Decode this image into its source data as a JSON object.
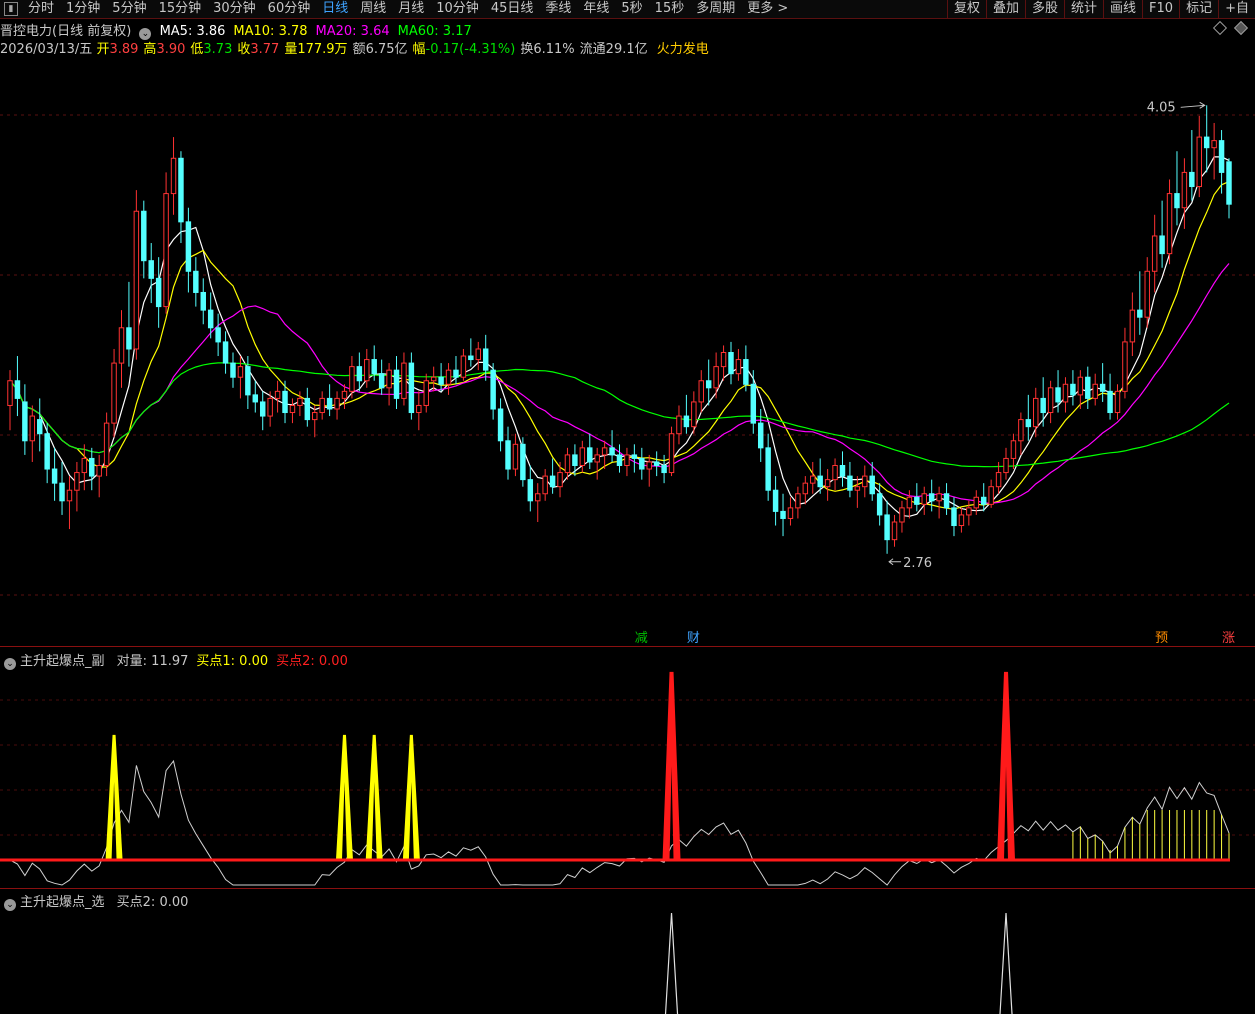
{
  "toolbar": {
    "periods": [
      "分时",
      "1分钟",
      "5分钟",
      "15分钟",
      "30分钟",
      "60分钟",
      "日线",
      "周线",
      "月线",
      "10分钟",
      "45日线",
      "季线",
      "年线",
      "5秒",
      "15秒",
      "多周期",
      "更多 >"
    ],
    "active_period": "日线",
    "right_buttons": [
      "复权",
      "叠加",
      "多股",
      "统计",
      "画线",
      "F10",
      "标记",
      "+自"
    ]
  },
  "header": {
    "stock": "晋控电力(日线 前复权)",
    "ma": [
      {
        "label": "MA5: 3.86",
        "color": "#ffffff"
      },
      {
        "label": "MA10: 3.78",
        "color": "#ffff00"
      },
      {
        "label": "MA20: 3.64",
        "color": "#ff00ff"
      },
      {
        "label": "MA60: 3.17",
        "color": "#00ff00"
      }
    ],
    "date": "2026/03/13/五",
    "quote": [
      {
        "k": "开",
        "v": "3.89",
        "color": "#ff4040"
      },
      {
        "k": "高",
        "v": "3.90",
        "color": "#ff4040"
      },
      {
        "k": "低",
        "v": "3.73",
        "color": "#00e000"
      },
      {
        "k": "收",
        "v": "3.77",
        "color": "#ff4040"
      },
      {
        "k": "量",
        "v": "177.9万",
        "color": "#ffff00"
      },
      {
        "k": "额",
        "v": "6.75亿",
        "color": "#c8c8c8"
      },
      {
        "k": "幅",
        "v": "-0.17(-4.31%)",
        "color": "#00e000"
      },
      {
        "k": "换",
        "v": "6.11%",
        "color": "#c8c8c8"
      },
      {
        "k": "流通",
        "v": "29.1亿",
        "color": "#c8c8c8"
      }
    ],
    "sector": "火力发电"
  },
  "panel1": {
    "title": "主升起爆点_副",
    "fields": [
      {
        "label": "对量: 11.97",
        "color": "#c8c8c8"
      },
      {
        "label": "买点1: 0.00",
        "color": "#ffff00"
      },
      {
        "label": "买点2: 0.00",
        "color": "#ff2020"
      }
    ]
  },
  "panel2": {
    "title": "主升起爆点_选",
    "fields": [
      {
        "label": "买点2: 0.00",
        "color": "#c8c8c8"
      }
    ]
  },
  "chart_data": {
    "type": "candlestick",
    "ylim": [
      2.55,
      4.15
    ],
    "high_label": "4.05",
    "low_label": "2.76",
    "markers": [
      {
        "text": "减",
        "index": 85,
        "color": "#00c000"
      },
      {
        "text": "财",
        "index": 92,
        "color": "#3fa3ff"
      },
      {
        "text": "预",
        "index": 155,
        "color": "#ff8c00"
      },
      {
        "text": "涨",
        "index": 164,
        "color": "#ff4040"
      }
    ],
    "candles": [
      [
        3.2,
        3.3,
        3.13,
        3.27
      ],
      [
        3.27,
        3.34,
        3.17,
        3.22
      ],
      [
        3.21,
        3.26,
        3.06,
        3.1
      ],
      [
        3.1,
        3.2,
        3.04,
        3.17
      ],
      [
        3.16,
        3.22,
        3.07,
        3.12
      ],
      [
        3.12,
        3.15,
        2.98,
        3.02
      ],
      [
        3.02,
        3.08,
        2.93,
        2.98
      ],
      [
        2.98,
        3.04,
        2.89,
        2.93
      ],
      [
        2.93,
        3.0,
        2.85,
        2.96
      ],
      [
        2.96,
        3.04,
        2.9,
        3.01
      ],
      [
        3.01,
        3.09,
        2.96,
        3.05
      ],
      [
        3.05,
        3.08,
        2.96,
        3.0
      ],
      [
        3.0,
        3.06,
        2.94,
        3.03
      ],
      [
        3.03,
        3.18,
        3.0,
        3.15
      ],
      [
        3.15,
        3.36,
        3.11,
        3.32
      ],
      [
        3.32,
        3.47,
        3.25,
        3.42
      ],
      [
        3.42,
        3.55,
        3.31,
        3.36
      ],
      [
        3.36,
        3.81,
        3.33,
        3.75
      ],
      [
        3.75,
        3.78,
        3.56,
        3.61
      ],
      [
        3.61,
        3.66,
        3.49,
        3.56
      ],
      [
        3.56,
        3.62,
        3.42,
        3.48
      ],
      [
        3.48,
        3.86,
        3.46,
        3.8
      ],
      [
        3.8,
        3.96,
        3.74,
        3.9
      ],
      [
        3.9,
        3.92,
        3.66,
        3.72
      ],
      [
        3.72,
        3.76,
        3.52,
        3.58
      ],
      [
        3.58,
        3.62,
        3.48,
        3.52
      ],
      [
        3.52,
        3.56,
        3.43,
        3.47
      ],
      [
        3.47,
        3.52,
        3.39,
        3.42
      ],
      [
        3.42,
        3.46,
        3.34,
        3.38
      ],
      [
        3.38,
        3.41,
        3.29,
        3.32
      ],
      [
        3.32,
        3.35,
        3.25,
        3.28
      ],
      [
        3.28,
        3.34,
        3.22,
        3.31
      ],
      [
        3.31,
        3.34,
        3.19,
        3.23
      ],
      [
        3.23,
        3.27,
        3.18,
        3.21
      ],
      [
        3.21,
        3.24,
        3.13,
        3.17
      ],
      [
        3.17,
        3.24,
        3.14,
        3.22
      ],
      [
        3.22,
        3.27,
        3.18,
        3.24
      ],
      [
        3.24,
        3.27,
        3.15,
        3.18
      ],
      [
        3.18,
        3.22,
        3.15,
        3.2
      ],
      [
        3.2,
        3.24,
        3.17,
        3.22
      ],
      [
        3.22,
        3.25,
        3.14,
        3.16
      ],
      [
        3.16,
        3.2,
        3.11,
        3.18
      ],
      [
        3.18,
        3.24,
        3.16,
        3.22
      ],
      [
        3.22,
        3.26,
        3.17,
        3.19
      ],
      [
        3.19,
        3.24,
        3.16,
        3.22
      ],
      [
        3.22,
        3.26,
        3.19,
        3.24
      ],
      [
        3.24,
        3.34,
        3.22,
        3.31
      ],
      [
        3.31,
        3.35,
        3.24,
        3.27
      ],
      [
        3.27,
        3.36,
        3.25,
        3.33
      ],
      [
        3.33,
        3.37,
        3.27,
        3.29
      ],
      [
        3.29,
        3.33,
        3.23,
        3.25
      ],
      [
        3.25,
        3.32,
        3.2,
        3.3
      ],
      [
        3.3,
        3.34,
        3.19,
        3.22
      ],
      [
        3.22,
        3.35,
        3.2,
        3.32
      ],
      [
        3.32,
        3.35,
        3.16,
        3.18
      ],
      [
        3.18,
        3.24,
        3.13,
        3.2
      ],
      [
        3.2,
        3.29,
        3.18,
        3.27
      ],
      [
        3.27,
        3.31,
        3.24,
        3.28
      ],
      [
        3.28,
        3.32,
        3.24,
        3.26
      ],
      [
        3.26,
        3.32,
        3.23,
        3.3
      ],
      [
        3.3,
        3.34,
        3.26,
        3.28
      ],
      [
        3.28,
        3.36,
        3.27,
        3.34
      ],
      [
        3.34,
        3.39,
        3.31,
        3.33
      ],
      [
        3.33,
        3.38,
        3.3,
        3.36
      ],
      [
        3.36,
        3.4,
        3.27,
        3.3
      ],
      [
        3.3,
        3.32,
        3.16,
        3.19
      ],
      [
        3.19,
        3.22,
        3.07,
        3.1
      ],
      [
        3.1,
        3.14,
        2.99,
        3.02
      ],
      [
        3.02,
        3.12,
        3.0,
        3.09
      ],
      [
        3.09,
        3.11,
        2.97,
        2.99
      ],
      [
        2.99,
        3.03,
        2.9,
        2.93
      ],
      [
        2.93,
        2.98,
        2.87,
        2.95
      ],
      [
        2.95,
        3.02,
        2.93,
        3.0
      ],
      [
        3.0,
        3.05,
        2.95,
        2.97
      ],
      [
        2.97,
        3.04,
        2.94,
        3.01
      ],
      [
        3.01,
        3.08,
        2.99,
        3.06
      ],
      [
        3.06,
        3.09,
        3.0,
        3.03
      ],
      [
        3.03,
        3.1,
        3.01,
        3.08
      ],
      [
        3.08,
        3.12,
        3.02,
        3.04
      ],
      [
        3.04,
        3.08,
        2.99,
        3.06
      ],
      [
        3.06,
        3.1,
        3.02,
        3.08
      ],
      [
        3.08,
        3.13,
        3.04,
        3.06
      ],
      [
        3.06,
        3.09,
        3.01,
        3.03
      ],
      [
        3.03,
        3.08,
        3.0,
        3.06
      ],
      [
        3.06,
        3.09,
        3.01,
        3.05
      ],
      [
        3.05,
        3.08,
        2.99,
        3.02
      ],
      [
        3.02,
        3.06,
        2.97,
        3.04
      ],
      [
        3.04,
        3.07,
        3.0,
        3.03
      ],
      [
        3.03,
        3.06,
        2.98,
        3.01
      ],
      [
        3.01,
        3.14,
        3.0,
        3.12
      ],
      [
        3.12,
        3.2,
        3.09,
        3.17
      ],
      [
        3.17,
        3.23,
        3.12,
        3.14
      ],
      [
        3.14,
        3.24,
        3.12,
        3.21
      ],
      [
        3.21,
        3.3,
        3.18,
        3.27
      ],
      [
        3.27,
        3.33,
        3.2,
        3.25
      ],
      [
        3.25,
        3.35,
        3.22,
        3.31
      ],
      [
        3.31,
        3.37,
        3.27,
        3.35
      ],
      [
        3.35,
        3.38,
        3.26,
        3.29
      ],
      [
        3.29,
        3.36,
        3.27,
        3.33
      ],
      [
        3.33,
        3.37,
        3.24,
        3.26
      ],
      [
        3.26,
        3.3,
        3.12,
        3.15
      ],
      [
        3.15,
        3.19,
        3.04,
        3.08
      ],
      [
        3.08,
        3.12,
        2.93,
        2.96
      ],
      [
        2.96,
        3.0,
        2.86,
        2.9
      ],
      [
        2.9,
        2.95,
        2.83,
        2.88
      ],
      [
        2.88,
        2.94,
        2.86,
        2.91
      ],
      [
        2.91,
        2.97,
        2.88,
        2.95
      ],
      [
        2.95,
        3.0,
        2.92,
        2.98
      ],
      [
        2.98,
        3.04,
        2.95,
        3.0
      ],
      [
        3.0,
        3.05,
        2.95,
        2.97
      ],
      [
        2.97,
        3.02,
        2.93,
        2.99
      ],
      [
        2.99,
        3.05,
        2.96,
        3.03
      ],
      [
        3.03,
        3.07,
        2.97,
        3.0
      ],
      [
        3.0,
        3.04,
        2.94,
        2.96
      ],
      [
        2.96,
        3.0,
        2.91,
        2.97
      ],
      [
        2.97,
        3.03,
        2.94,
        3.0
      ],
      [
        3.0,
        3.04,
        2.93,
        2.95
      ],
      [
        2.95,
        2.98,
        2.86,
        2.89
      ],
      [
        2.89,
        2.93,
        2.78,
        2.82
      ],
      [
        2.82,
        2.89,
        2.8,
        2.87
      ],
      [
        2.87,
        2.93,
        2.84,
        2.91
      ],
      [
        2.91,
        2.96,
        2.88,
        2.94
      ],
      [
        2.94,
        2.98,
        2.9,
        2.92
      ],
      [
        2.92,
        2.97,
        2.89,
        2.95
      ],
      [
        2.95,
        2.99,
        2.9,
        2.93
      ],
      [
        2.93,
        2.97,
        2.88,
        2.95
      ],
      [
        2.95,
        2.98,
        2.89,
        2.91
      ],
      [
        2.91,
        2.94,
        2.83,
        2.86
      ],
      [
        2.86,
        2.91,
        2.84,
        2.89
      ],
      [
        2.89,
        2.93,
        2.86,
        2.91
      ],
      [
        2.91,
        2.96,
        2.89,
        2.94
      ],
      [
        2.94,
        2.98,
        2.9,
        2.92
      ],
      [
        2.92,
        2.99,
        2.91,
        2.97
      ],
      [
        2.97,
        3.04,
        2.95,
        3.01
      ],
      [
        3.01,
        3.08,
        2.99,
        3.05
      ],
      [
        3.05,
        3.12,
        3.02,
        3.1
      ],
      [
        3.1,
        3.18,
        3.06,
        3.16
      ],
      [
        3.16,
        3.23,
        3.1,
        3.14
      ],
      [
        3.14,
        3.25,
        3.11,
        3.22
      ],
      [
        3.22,
        3.28,
        3.14,
        3.18
      ],
      [
        3.18,
        3.27,
        3.15,
        3.25
      ],
      [
        3.25,
        3.3,
        3.18,
        3.21
      ],
      [
        3.21,
        3.28,
        3.18,
        3.26
      ],
      [
        3.26,
        3.3,
        3.2,
        3.23
      ],
      [
        3.23,
        3.3,
        3.19,
        3.28
      ],
      [
        3.28,
        3.31,
        3.19,
        3.22
      ],
      [
        3.22,
        3.29,
        3.2,
        3.26
      ],
      [
        3.26,
        3.32,
        3.21,
        3.24
      ],
      [
        3.24,
        3.29,
        3.16,
        3.18
      ],
      [
        3.18,
        3.26,
        3.16,
        3.24
      ],
      [
        3.24,
        3.42,
        3.22,
        3.38
      ],
      [
        3.38,
        3.52,
        3.34,
        3.47
      ],
      [
        3.47,
        3.58,
        3.4,
        3.45
      ],
      [
        3.45,
        3.62,
        3.42,
        3.58
      ],
      [
        3.58,
        3.74,
        3.52,
        3.68
      ],
      [
        3.68,
        3.78,
        3.59,
        3.63
      ],
      [
        3.63,
        3.84,
        3.6,
        3.8
      ],
      [
        3.8,
        3.92,
        3.71,
        3.76
      ],
      [
        3.76,
        3.9,
        3.7,
        3.86
      ],
      [
        3.86,
        3.98,
        3.78,
        3.82
      ],
      [
        3.82,
        4.02,
        3.79,
        3.96
      ],
      [
        3.96,
        4.05,
        3.86,
        3.93
      ],
      [
        3.93,
        4.0,
        3.84,
        3.95
      ],
      [
        3.95,
        3.98,
        3.8,
        3.86
      ],
      [
        3.89,
        3.9,
        3.73,
        3.77
      ]
    ],
    "moving_averages": [
      {
        "name": "MA5",
        "color": "#ffffff"
      },
      {
        "name": "MA10",
        "color": "#ffff00"
      },
      {
        "name": "MA20",
        "color": "#ff00ff"
      },
      {
        "name": "MA60",
        "color": "#00ff00"
      }
    ],
    "panel1_signals": {
      "buy1_spike_indices": [
        14,
        45,
        49,
        54
      ],
      "buy2_spike_indices": [
        89,
        134
      ],
      "buy2_spike_indices_panel2": [
        89,
        134
      ]
    }
  }
}
